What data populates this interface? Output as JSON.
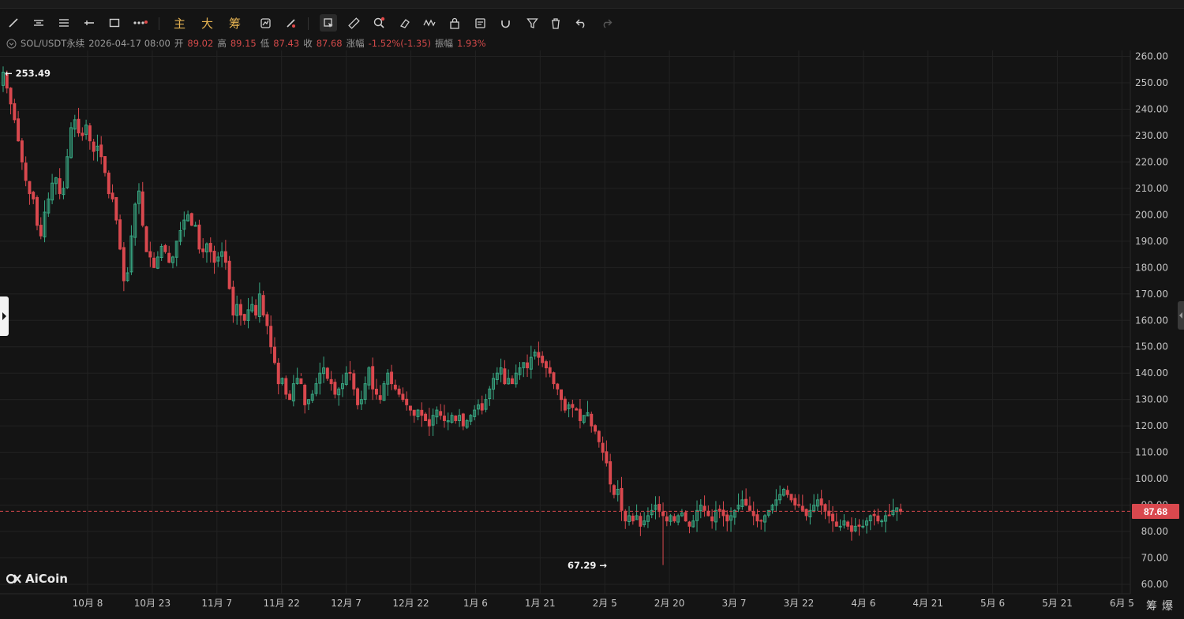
{
  "toolbar": {
    "tools": [
      "trend-line-icon",
      "parallel-lines-icon",
      "horizontal-lines-icon",
      "horizontal-ray-icon",
      "rectangle-icon",
      "more-shapes-icon"
    ],
    "indicators": [
      "主",
      "大",
      "筹"
    ],
    "tools2": [
      "auto-draw-icon",
      "brush-icon",
      "select-icon",
      "ruler-icon",
      "zoom-icon",
      "eraser-icon",
      "pattern-icon",
      "lock-icon",
      "template-icon",
      "magnet-icon",
      "filter-icon",
      "delete-icon",
      "undo-icon",
      "redo-icon"
    ]
  },
  "info": {
    "symbol": "SOL/USDT永续",
    "datetime": "2026-04-17 08:00",
    "open_label": "开",
    "open": "89.02",
    "high_label": "高",
    "high": "89.15",
    "low_label": "低",
    "low": "87.43",
    "close_label": "收",
    "close": "87.68",
    "change_label": "涨幅",
    "change": "-1.52%(-1.35)",
    "amp_label": "振幅",
    "amp": "1.93%"
  },
  "chart_data": {
    "type": "candlestick",
    "y_ticks": [
      "260.00",
      "250.00",
      "240.00",
      "230.00",
      "220.00",
      "210.00",
      "200.00",
      "190.00",
      "180.00",
      "170.00",
      "160.00",
      "150.00",
      "140.00",
      "130.00",
      "120.00",
      "110.00",
      "100.00",
      "90.00",
      "80.00",
      "70.00",
      "60.00"
    ],
    "x_ticks": [
      "10月 8",
      "10月 23",
      "11月 7",
      "11月 22",
      "12月 7",
      "12月 22",
      "1月 6",
      "1月 21",
      "2月 5",
      "2月 20",
      "3月 7",
      "3月 22",
      "4月 6",
      "4月 21",
      "5月 6",
      "5月 21",
      "6月 5"
    ],
    "ylim": [
      57,
      263
    ],
    "last_price": "87.68",
    "high_marker": "253.49",
    "low_marker": "67.29",
    "series": [
      254,
      248,
      242,
      236,
      228,
      220,
      213,
      208,
      206,
      196,
      192,
      201,
      206,
      212,
      214,
      208,
      210,
      222,
      233,
      236,
      231,
      230,
      234,
      228,
      224,
      226,
      222,
      216,
      208,
      206,
      198,
      187,
      175,
      178,
      192,
      204,
      209,
      196,
      186,
      184,
      180,
      184,
      188,
      186,
      182,
      184,
      190,
      194,
      198,
      200,
      196,
      196,
      187,
      186,
      189,
      186,
      182,
      184,
      186,
      182,
      172,
      162,
      166,
      162,
      160,
      164,
      166,
      162,
      170,
      162,
      158,
      150,
      144,
      136,
      138,
      132,
      130,
      136,
      138,
      136,
      128,
      130,
      132,
      136,
      140,
      142,
      138,
      136,
      132,
      134,
      136,
      140,
      140,
      134,
      128,
      130,
      136,
      142,
      134,
      132,
      130,
      136,
      140,
      136,
      134,
      132,
      130,
      128,
      126,
      124,
      126,
      124,
      122,
      120,
      124,
      126,
      124,
      122,
      122,
      124,
      122,
      124,
      120,
      122,
      124,
      126,
      128,
      126,
      130,
      134,
      138,
      140,
      142,
      136,
      138,
      136,
      140,
      142,
      144,
      142,
      146,
      148,
      146,
      144,
      142,
      140,
      136,
      134,
      130,
      126,
      128,
      127,
      126,
      122,
      124,
      125,
      120,
      118,
      114,
      110,
      106,
      98,
      94,
      96,
      88,
      84,
      86,
      84,
      86,
      82,
      84,
      86,
      88,
      90,
      88,
      86,
      84,
      86,
      84,
      86,
      87,
      84,
      82,
      84,
      88,
      90,
      88,
      86,
      84,
      88,
      88,
      86,
      84,
      86,
      88,
      90,
      92,
      90,
      88,
      86,
      84,
      84,
      86,
      88,
      90,
      92,
      94,
      96,
      94,
      92,
      90,
      90,
      88,
      86,
      88,
      90,
      92,
      90,
      88,
      86,
      84,
      82,
      82,
      84,
      82,
      80,
      82,
      82,
      82,
      84,
      86,
      86,
      84,
      84,
      86,
      86,
      88,
      89,
      87.68
    ]
  }
}
